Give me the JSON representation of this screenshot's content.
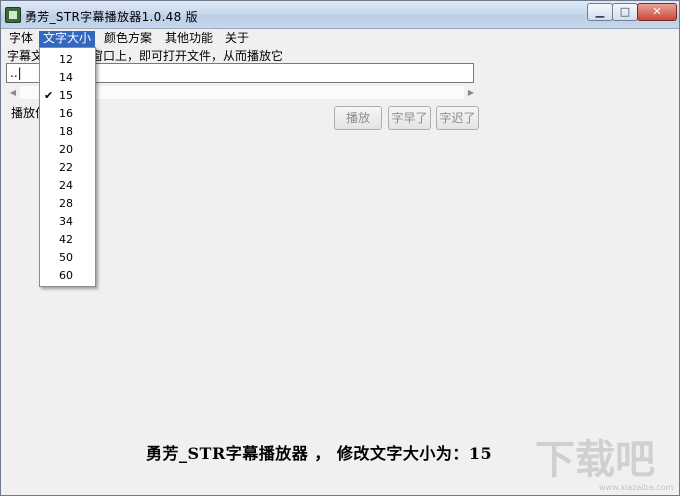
{
  "window": {
    "title": "勇芳_STR字幕播放器1.0.48 版",
    "min_glyph": "▁",
    "max_glyph": "□",
    "close_glyph": "✕"
  },
  "menu": {
    "items": [
      "字体",
      "文字大小",
      "颜色方案",
      "其他功能",
      "关于"
    ],
    "active_index": 1
  },
  "main": {
    "hint": "字幕文件拖到本窗口上，即可打开文件，从而播放它",
    "path_value": "..|",
    "play_label": "播放位置",
    "buttons": {
      "play": "播放",
      "earlier": "字早了",
      "later": "字迟了"
    }
  },
  "font_size_menu": {
    "options": [
      "12",
      "14",
      "15",
      "16",
      "18",
      "20",
      "22",
      "24",
      "28",
      "34",
      "42",
      "50",
      "60"
    ],
    "checked": "15",
    "check_glyph": "✔"
  },
  "subtitle": {
    "text": "勇芳_STR字幕播放器 ， 修改文字大小为：15"
  },
  "watermark": {
    "text": "下载吧",
    "url": "www.xiazaiba.com"
  },
  "colors": {
    "menu_highlight": "#3368c0",
    "disabled_text": "#8d8d8d"
  }
}
